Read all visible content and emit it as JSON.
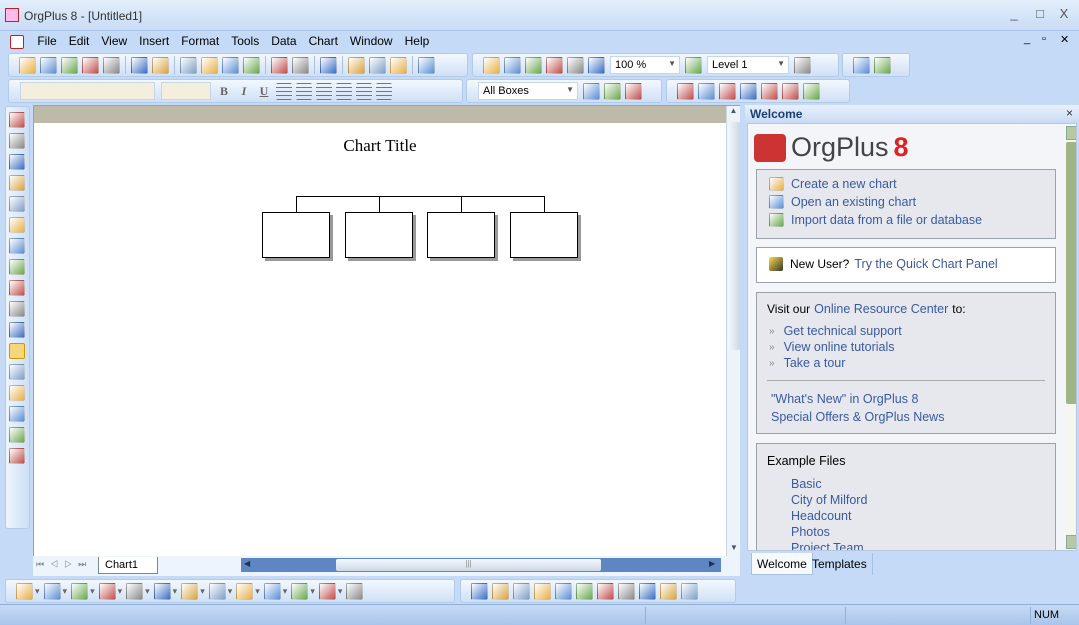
{
  "window": {
    "title": "OrgPlus 8 - [Untitled1]",
    "controls": [
      "_",
      "□",
      "X"
    ],
    "mdi_controls": [
      "_",
      "▫",
      "✕"
    ]
  },
  "menu": [
    "File",
    "Edit",
    "View",
    "Insert",
    "Format",
    "Tools",
    "Data",
    "Chart",
    "Window",
    "Help"
  ],
  "toolbar1": {
    "icons_a": [
      "new-icon",
      "open-icon",
      "save-icon",
      "email-icon",
      "excel-icon",
      "print-icon",
      "print-preview-icon",
      "cut-icon",
      "copy-icon",
      "paste-icon",
      "format-painter-icon",
      "undo-icon",
      "redo-icon",
      "refresh-icon",
      "person-icon",
      "manager-icon",
      "group-icon",
      "help-icon"
    ],
    "icons_b": [
      "zoom-in-icon",
      "zoom-out-icon",
      "zoom-box-icon",
      "zoom-fit-icon",
      "pan-hand-icon",
      "page-icon"
    ],
    "zoom_value": "100 %",
    "level_value": "Level 1",
    "icons_c": [
      "subchart-icon",
      "table-icon",
      "text-field-icon"
    ]
  },
  "toolbar2": {
    "font_value": "",
    "size_value": "",
    "format_buttons": [
      "B",
      "I",
      "U"
    ],
    "select_value": "All Boxes",
    "icons_b": [
      "select-boxes-icon",
      "branch-icon",
      "chart-icon"
    ],
    "icons_c": [
      "powerpoint-icon",
      "word-icon",
      "web-publish-icon",
      "internet-explorer-icon",
      "pdf-icon",
      "export-chart-icon",
      "import-icon"
    ]
  },
  "left_tools": [
    "pointer-icon",
    "connect-tool-icon",
    "move-icon",
    "move-branch-icon",
    "box-subordinate-icon",
    "box-assistant-icon",
    "box-coworker-icon",
    "box-manager-icon",
    "box-group-icon",
    "line-tool-icon",
    "line-tool2-icon",
    "step-line-icon",
    "rectangle-icon",
    "rounded-rectangle-icon",
    "ellipse-icon",
    "text-box-icon",
    "image-icon"
  ],
  "chart": {
    "title": "Chart Title",
    "sheet_tab": "Chart1"
  },
  "bottom_toolbar": [
    "border-style-icon",
    "line-weight-icon",
    "line-style-icon",
    "connector-icon",
    "line-color-icon",
    "shape-icon",
    "fill-color-icon",
    "shadow-icon",
    "shadow2-icon",
    "shadow3-icon",
    "box-shadow-icon",
    "arrange-icon",
    "layout-icon",
    "info-icon",
    "properties-icon",
    "fields-icon",
    "list-icon",
    "grid-icon",
    "org-icon",
    "find-icon",
    "wizard-icon",
    "note-icon",
    "tree-icon",
    "sum-icon"
  ],
  "panel": {
    "title": "Welcome",
    "brand": "OrgPlus",
    "brand_version": "8",
    "start_links": [
      {
        "icon": "new-chart-icon",
        "label": "Create a new chart"
      },
      {
        "icon": "open-folder-icon",
        "label": "Open an existing chart"
      },
      {
        "icon": "import-data-icon",
        "label": "Import data from a file or database"
      }
    ],
    "new_user": {
      "prefix": "New User?",
      "link": "Try the Quick Chart Panel"
    },
    "visit": {
      "prefix": "Visit our",
      "link": "Online Resource Center",
      "suffix": "to:",
      "items": [
        "Get technical support",
        "View online tutorials",
        "Take a tour"
      ],
      "extra": [
        "\"What's New\" in OrgPlus 8",
        "Special Offers & OrgPlus News"
      ]
    },
    "examples": {
      "heading": "Example Files",
      "items": [
        "Basic",
        "City of Milford",
        "Headcount",
        "Photos",
        "Project Team"
      ]
    },
    "tabs": [
      "Welcome",
      "Templates"
    ]
  },
  "status": {
    "num": "NUM"
  }
}
